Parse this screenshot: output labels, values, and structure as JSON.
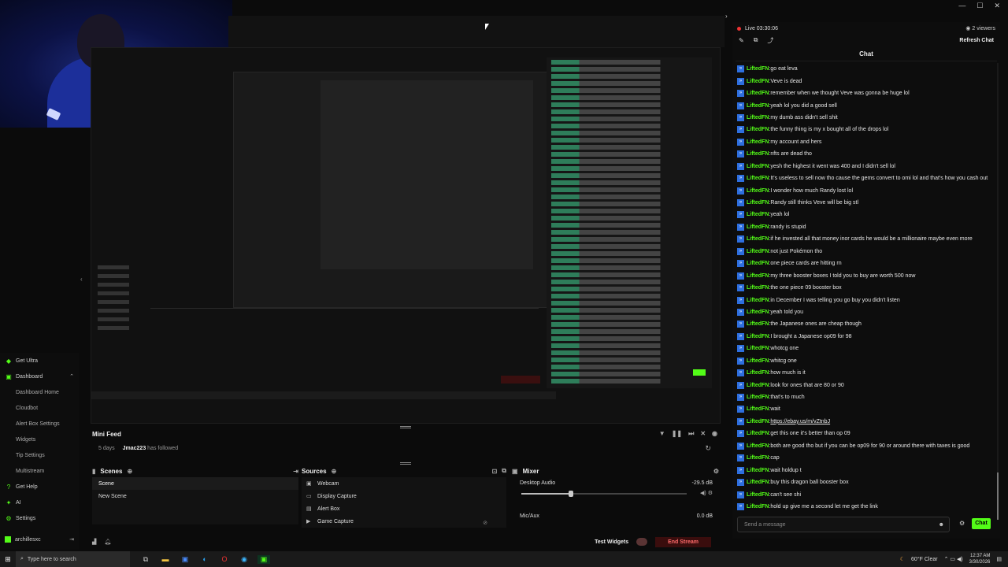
{
  "window": {
    "controls": [
      "—",
      "☐",
      "✕"
    ],
    "collapse_icon": "›"
  },
  "stream": {
    "live_label": "Live 03:30:06",
    "viewers": "2 viewers",
    "refresh_chat": "Refresh Chat"
  },
  "sidebar": {
    "items": [
      {
        "label": "Get Ultra",
        "icon": "ultra-icon",
        "glyph": "◆",
        "sub": false
      },
      {
        "label": "Dashboard",
        "icon": "dashboard-icon",
        "glyph": "▣",
        "sub": false,
        "expanded": true
      },
      {
        "label": "Dashboard Home",
        "sub": true
      },
      {
        "label": "Cloudbot",
        "sub": true
      },
      {
        "label": "Alert Box Settings",
        "sub": true
      },
      {
        "label": "Widgets",
        "sub": true
      },
      {
        "label": "Tip Settings",
        "sub": true
      },
      {
        "label": "Multistream",
        "sub": true
      },
      {
        "label": "Get Help",
        "icon": "help-icon",
        "glyph": "?",
        "sub": false
      },
      {
        "label": "AI",
        "icon": "ai-icon",
        "glyph": "✦",
        "sub": false
      },
      {
        "label": "Settings",
        "icon": "settings-icon",
        "glyph": "⚙",
        "sub": false
      }
    ],
    "user": "archillesxc"
  },
  "mini_feed": {
    "title": "Mini Feed",
    "event": {
      "age": "5 days",
      "user": "Jmac223",
      "action": "has followed"
    }
  },
  "scenes": {
    "title": "Scenes",
    "items": [
      "Scene",
      "New Scene"
    ],
    "selected": 0
  },
  "sources": {
    "title": "Sources",
    "items": [
      {
        "label": "Webcam",
        "glyph": "▣"
      },
      {
        "label": "Display Capture",
        "glyph": "▭"
      },
      {
        "label": "Alert Box",
        "glyph": "▤"
      },
      {
        "label": "Game Capture",
        "glyph": "▶"
      }
    ]
  },
  "mixer": {
    "title": "Mixer",
    "channels": [
      {
        "name": "Desktop Audio",
        "level": "-29.5 dB",
        "fader": 0.3
      },
      {
        "name": "Mic/Aux",
        "level": "0.0 dB"
      }
    ]
  },
  "footer": {
    "test_widgets": "Test Widgets",
    "end_stream": "End Stream"
  },
  "chat": {
    "title": "Chat",
    "input_placeholder": "Send a message",
    "send_label": "Chat",
    "username": "LiftedFN",
    "messages": [
      "go eat leva",
      "Veve is dead",
      "remember when we thought Veve was gonna be huge lol",
      "yeah lol you did a good sell",
      "my dumb ass didn't sell shit",
      "the funny thing is my x bought all of the drops lol",
      "my account and hers",
      "nfts are dead tho",
      "yesh the highest it went was 400 and I didn't sell lol",
      "It's useless to sell now tho cause the gems convert to omi lol and that's how you cash out",
      "I wonder how much Randy lost lol",
      "Randy still thinks Veve will be big stl",
      "yeah lol",
      "randy is stupid",
      "if he invested all that money inor cards he would be a millionaire maybe even more",
      "not just Pokémon tho",
      "one piece cards are hitting rn",
      "my three booster boxes I told you to buy are worth 500 now",
      "the one piece 09 booster box",
      "in December I was telling you go buy you didn't listen",
      "yeah told you",
      "the Japanese ones are cheap though",
      "I brought a Japanese op09 for 98",
      "whotcg one",
      "whitcg one",
      "how much is it",
      "look for ones that are 80 or 90",
      "that's to much",
      "wait",
      "https://ebay.us/m/vZtnbJ",
      "get this one it's better than op 09",
      "both are good tho but if you can be op09 for 90 or around there with taxes is good",
      "cap",
      "wait holdup t",
      "buy this dragon ball booster box",
      "can't see shi",
      "hold up give me a second let me get the link"
    ]
  },
  "taskbar": {
    "search_placeholder": "Type here to search",
    "weather": "60°F Clear",
    "time": "12:37 AM",
    "date": "3/30/2026"
  }
}
